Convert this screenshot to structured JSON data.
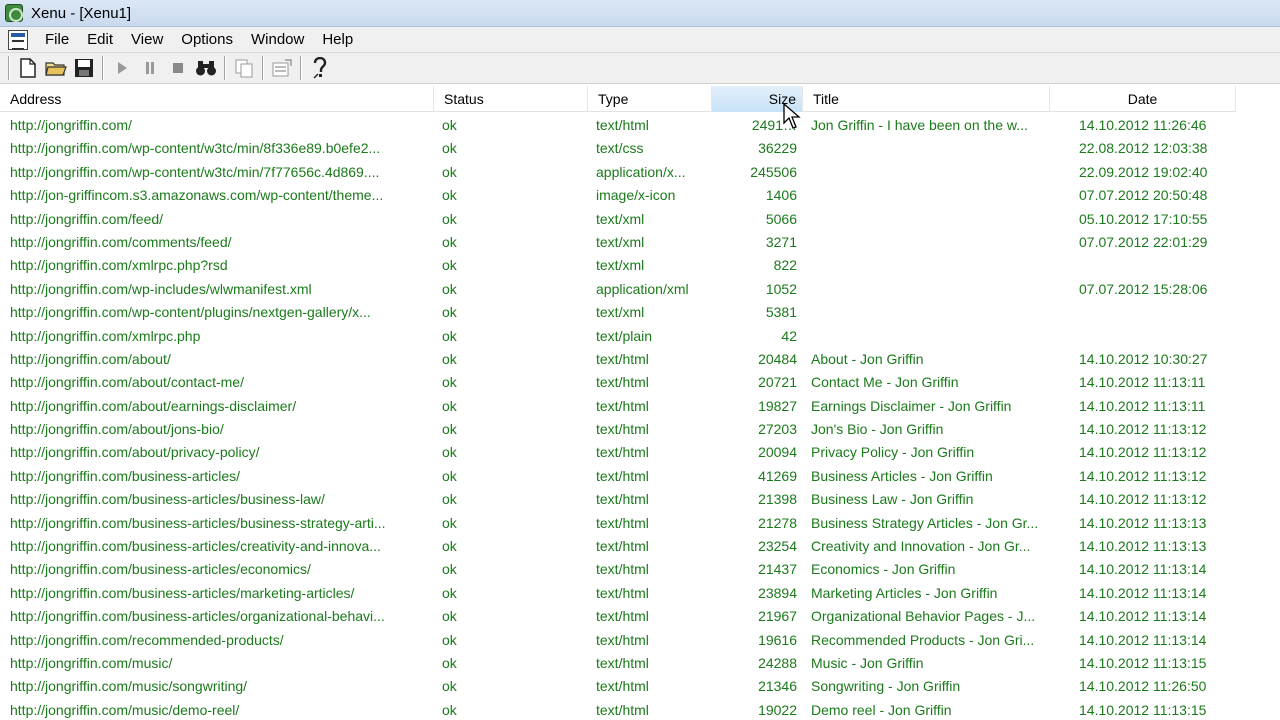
{
  "window": {
    "title": "Xenu - [Xenu1]"
  },
  "menu": {
    "items": [
      "File",
      "Edit",
      "View",
      "Options",
      "Window",
      "Help"
    ]
  },
  "toolbar": {
    "buttons": [
      "new-document-icon",
      "open-folder-icon",
      "save-icon",
      "play-icon",
      "pause-icon",
      "stop-icon",
      "find-binoculars-icon",
      "copy-icon",
      "properties-icon",
      "help-icon"
    ]
  },
  "table": {
    "columns": {
      "address": "Address",
      "status": "Status",
      "type": "Type",
      "size": "Size",
      "title": "Title",
      "date": "Date"
    },
    "sorted_column": "Size",
    "rows": [
      [
        "http://jongriffin.com/",
        "ok",
        "text/html",
        "2491…",
        "Jon Griffin - I have been on the w...",
        "14.10.2012  11:26:46"
      ],
      [
        "http://jongriffin.com/wp-content/w3tc/min/8f336e89.b0efe2...",
        "ok",
        "text/css",
        "36229",
        "",
        "22.08.2012  12:03:38"
      ],
      [
        "http://jongriffin.com/wp-content/w3tc/min/7f77656c.4d869....",
        "ok",
        "application/x...",
        "245506",
        "",
        "22.09.2012  19:02:40"
      ],
      [
        "http://jon-griffincom.s3.amazonaws.com/wp-content/theme...",
        "ok",
        "image/x-icon",
        "1406",
        "",
        "07.07.2012  20:50:48"
      ],
      [
        "http://jongriffin.com/feed/",
        "ok",
        "text/xml",
        "5066",
        "",
        "05.10.2012  17:10:55"
      ],
      [
        "http://jongriffin.com/comments/feed/",
        "ok",
        "text/xml",
        "3271",
        "",
        "07.07.2012  22:01:29"
      ],
      [
        "http://jongriffin.com/xmlrpc.php?rsd",
        "ok",
        "text/xml",
        "822",
        "",
        ""
      ],
      [
        "http://jongriffin.com/wp-includes/wlwmanifest.xml",
        "ok",
        "application/xml",
        "1052",
        "",
        "07.07.2012  15:28:06"
      ],
      [
        "http://jongriffin.com/wp-content/plugins/nextgen-gallery/x...",
        "ok",
        "text/xml",
        "5381",
        "",
        ""
      ],
      [
        "http://jongriffin.com/xmlrpc.php",
        "ok",
        "text/plain",
        "42",
        "",
        ""
      ],
      [
        "http://jongriffin.com/about/",
        "ok",
        "text/html",
        "20484",
        "About - Jon Griffin",
        "14.10.2012  10:30:27"
      ],
      [
        "http://jongriffin.com/about/contact-me/",
        "ok",
        "text/html",
        "20721",
        "Contact Me - Jon Griffin",
        "14.10.2012  11:13:11"
      ],
      [
        "http://jongriffin.com/about/earnings-disclaimer/",
        "ok",
        "text/html",
        "19827",
        "Earnings Disclaimer - Jon Griffin",
        "14.10.2012  11:13:11"
      ],
      [
        "http://jongriffin.com/about/jons-bio/",
        "ok",
        "text/html",
        "27203",
        "Jon's Bio - Jon Griffin",
        "14.10.2012  11:13:12"
      ],
      [
        "http://jongriffin.com/about/privacy-policy/",
        "ok",
        "text/html",
        "20094",
        "Privacy Policy - Jon Griffin",
        "14.10.2012  11:13:12"
      ],
      [
        "http://jongriffin.com/business-articles/",
        "ok",
        "text/html",
        "41269",
        "Business Articles - Jon Griffin",
        "14.10.2012  11:13:12"
      ],
      [
        "http://jongriffin.com/business-articles/business-law/",
        "ok",
        "text/html",
        "21398",
        "Business Law - Jon Griffin",
        "14.10.2012  11:13:12"
      ],
      [
        "http://jongriffin.com/business-articles/business-strategy-arti...",
        "ok",
        "text/html",
        "21278",
        "Business Strategy Articles - Jon Gr...",
        "14.10.2012  11:13:13"
      ],
      [
        "http://jongriffin.com/business-articles/creativity-and-innova...",
        "ok",
        "text/html",
        "23254",
        "Creativity and Innovation - Jon Gr...",
        "14.10.2012  11:13:13"
      ],
      [
        "http://jongriffin.com/business-articles/economics/",
        "ok",
        "text/html",
        "21437",
        "Economics - Jon Griffin",
        "14.10.2012  11:13:14"
      ],
      [
        "http://jongriffin.com/business-articles/marketing-articles/",
        "ok",
        "text/html",
        "23894",
        "Marketing Articles - Jon Griffin",
        "14.10.2012  11:13:14"
      ],
      [
        "http://jongriffin.com/business-articles/organizational-behavi...",
        "ok",
        "text/html",
        "21967",
        "Organizational Behavior Pages - J...",
        "14.10.2012  11:13:14"
      ],
      [
        "http://jongriffin.com/recommended-products/",
        "ok",
        "text/html",
        "19616",
        "Recommended Products - Jon Gri...",
        "14.10.2012  11:13:14"
      ],
      [
        "http://jongriffin.com/music/",
        "ok",
        "text/html",
        "24288",
        "Music - Jon Griffin",
        "14.10.2012  11:13:15"
      ],
      [
        "http://jongriffin.com/music/songwriting/",
        "ok",
        "text/html",
        "21346",
        "Songwriting - Jon Griffin",
        "14.10.2012  11:26:50"
      ],
      [
        "http://jongriffin.com/music/demo-reel/",
        "ok",
        "text/html",
        "19022",
        "Demo reel - Jon Griffin",
        "14.10.2012  11:13:15"
      ]
    ]
  },
  "colors": {
    "link_green": "#1b7a1b",
    "sorted_header": "#c7e1f7",
    "titlebar": "#c9d9ee"
  }
}
